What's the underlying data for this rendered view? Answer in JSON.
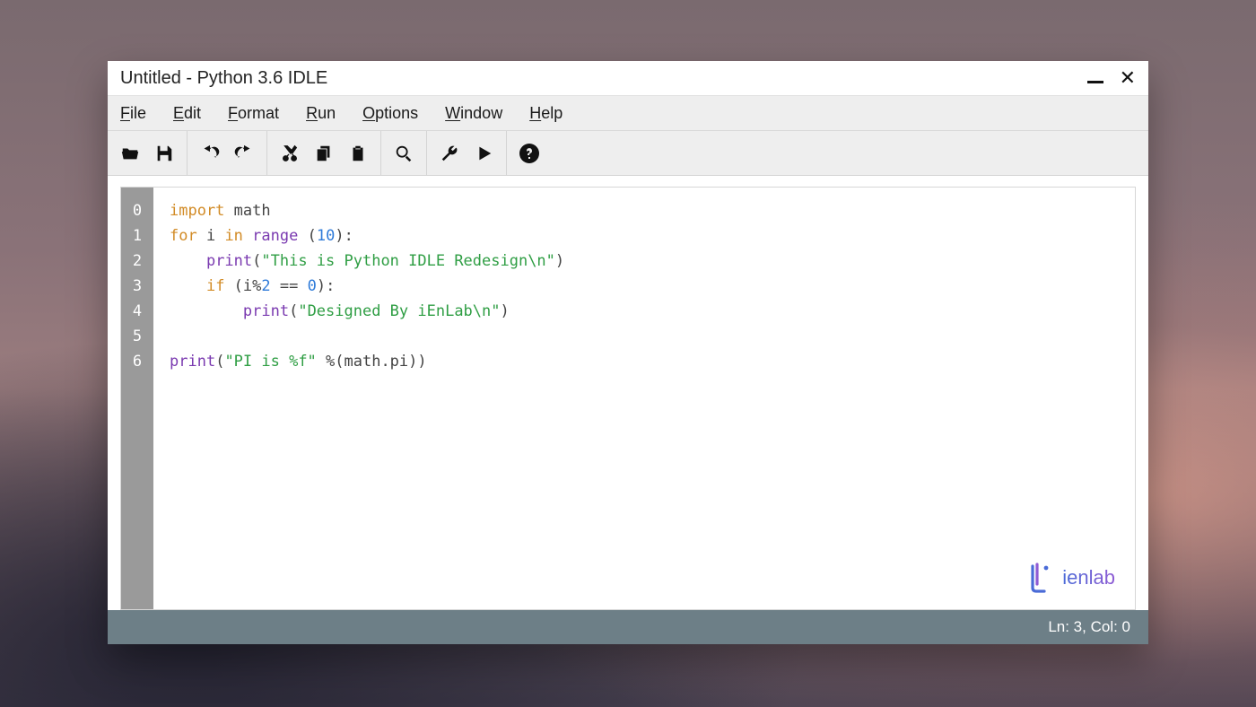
{
  "window": {
    "title": "Untitled - Python 3.6 IDLE"
  },
  "menubar": {
    "items": [
      {
        "label": "File",
        "accel": "F"
      },
      {
        "label": "Edit",
        "accel": "E"
      },
      {
        "label": "Format",
        "accel": "F"
      },
      {
        "label": "Run",
        "accel": "R"
      },
      {
        "label": "Options",
        "accel": "O"
      },
      {
        "label": "Window",
        "accel": "W"
      },
      {
        "label": "Help",
        "accel": "H"
      }
    ]
  },
  "toolbar": {
    "groups": [
      [
        {
          "icon": "folder-open-icon",
          "name": "open-button"
        },
        {
          "icon": "save-icon",
          "name": "save-button"
        }
      ],
      [
        {
          "icon": "undo-icon",
          "name": "undo-button"
        },
        {
          "icon": "redo-icon",
          "name": "redo-button"
        }
      ],
      [
        {
          "icon": "cut-icon",
          "name": "cut-button"
        },
        {
          "icon": "copy-icon",
          "name": "copy-button"
        },
        {
          "icon": "paste-icon",
          "name": "paste-button"
        }
      ],
      [
        {
          "icon": "search-icon",
          "name": "search-button"
        }
      ],
      [
        {
          "icon": "wrench-icon",
          "name": "settings-button"
        },
        {
          "icon": "play-icon",
          "name": "run-button"
        }
      ],
      [
        {
          "icon": "help-icon",
          "name": "help-button"
        }
      ]
    ]
  },
  "editor": {
    "line_numbers": [
      "0",
      "1",
      "2",
      "3",
      "4",
      "5",
      "6"
    ],
    "lines": [
      [
        {
          "t": "import",
          "c": "kw"
        },
        {
          "t": " ",
          "c": "pun"
        },
        {
          "t": "math",
          "c": "id"
        }
      ],
      [
        {
          "t": "for",
          "c": "kw"
        },
        {
          "t": " i ",
          "c": "id"
        },
        {
          "t": "in",
          "c": "kw"
        },
        {
          "t": " ",
          "c": "pun"
        },
        {
          "t": "range",
          "c": "fn"
        },
        {
          "t": " (",
          "c": "pun"
        },
        {
          "t": "10",
          "c": "num"
        },
        {
          "t": "):",
          "c": "pun"
        }
      ],
      [
        {
          "t": "    ",
          "c": "pun"
        },
        {
          "t": "print",
          "c": "fn"
        },
        {
          "t": "(",
          "c": "pun"
        },
        {
          "t": "\"This is Python IDLE Redesign\\n\"",
          "c": "str"
        },
        {
          "t": ")",
          "c": "pun"
        }
      ],
      [
        {
          "t": "    ",
          "c": "pun"
        },
        {
          "t": "if",
          "c": "kw"
        },
        {
          "t": " (i%",
          "c": "pun"
        },
        {
          "t": "2",
          "c": "num"
        },
        {
          "t": " == ",
          "c": "pun"
        },
        {
          "t": "0",
          "c": "num"
        },
        {
          "t": "):",
          "c": "pun"
        }
      ],
      [
        {
          "t": "        ",
          "c": "pun"
        },
        {
          "t": "print",
          "c": "fn"
        },
        {
          "t": "(",
          "c": "pun"
        },
        {
          "t": "\"Designed By iEnLab\\n\"",
          "c": "str"
        },
        {
          "t": ")",
          "c": "pun"
        }
      ],
      [],
      [
        {
          "t": "print",
          "c": "fn"
        },
        {
          "t": "(",
          "c": "pun"
        },
        {
          "t": "\"PI is %f\"",
          "c": "str"
        },
        {
          "t": " %(math.pi))",
          "c": "pun"
        }
      ]
    ]
  },
  "logo": {
    "text": "ienlab"
  },
  "statusbar": {
    "position": "Ln: 3, Col: 0"
  }
}
